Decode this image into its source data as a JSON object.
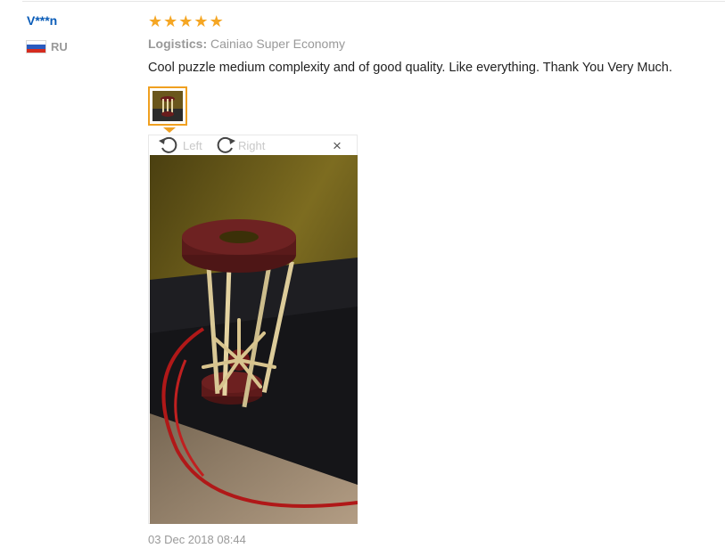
{
  "review": {
    "user_name": "V***n",
    "country_code": "RU",
    "rating": 5,
    "stars": [
      "★",
      "★",
      "★",
      "★",
      "★"
    ],
    "logistics_label": "Logistics:",
    "logistics_value": "Cainiao Super Economy",
    "text": "Cool puzzle medium complexity and of good quality. Like everything. Thank You Very Much.",
    "date": "03 Dec 2018 08:44"
  },
  "viewer": {
    "rotate_left_label": "Left",
    "rotate_right_label": "Right",
    "close_glyph": "×"
  },
  "colors": {
    "username": "#0a5cb8",
    "star": "#f5a623",
    "thumb_border": "#f0a020",
    "muted_text": "#999999"
  },
  "icons": [
    "russia-flag-icon",
    "star-icon",
    "rotate-left-icon",
    "rotate-right-icon",
    "close-icon"
  ]
}
